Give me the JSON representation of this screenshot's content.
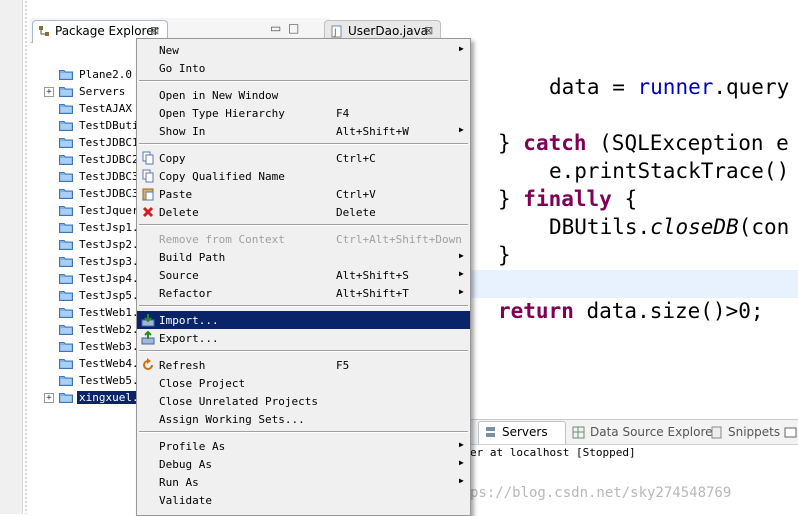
{
  "package_explorer": {
    "tab_label": "Package Explorer",
    "minimize_glyph": "▭",
    "maximize_glyph": "□",
    "close_glyph": "⊠",
    "tree": [
      {
        "label": "Plane2.0",
        "expandable": false
      },
      {
        "label": "Servers",
        "expandable": true
      },
      {
        "label": "TestAJAX",
        "expandable": false
      },
      {
        "label": "TestDButi",
        "expandable": false
      },
      {
        "label": "TestJDBC1",
        "expandable": false
      },
      {
        "label": "TestJDBC2",
        "expandable": false
      },
      {
        "label": "TestJDBC3",
        "expandable": false
      },
      {
        "label": "TestJDBC3",
        "expandable": false
      },
      {
        "label": "TestJquer",
        "expandable": false
      },
      {
        "label": "TestJsp1.",
        "expandable": false
      },
      {
        "label": "TestJsp2.",
        "expandable": false
      },
      {
        "label": "TestJsp3.",
        "expandable": false
      },
      {
        "label": "TestJsp4.",
        "expandable": false
      },
      {
        "label": "TestJsp5.",
        "expandable": false
      },
      {
        "label": "TestWeb1.",
        "expandable": false
      },
      {
        "label": "TestWeb2.",
        "expandable": false
      },
      {
        "label": "TestWeb3.",
        "expandable": false
      },
      {
        "label": "TestWeb4.",
        "expandable": false
      },
      {
        "label": "TestWeb5.",
        "expandable": false
      },
      {
        "label": "xingxuel.",
        "expandable": true,
        "selected": true
      }
    ]
  },
  "editor": {
    "tab_label": "UserDao.java",
    "code": {
      "l1_a": "data = ",
      "l1_b": "runner",
      "l1_c": ".query",
      "l2_a": "} ",
      "l2_kw": "catch",
      "l2_b": " (SQLException e",
      "l3": "e.printStackTrace()",
      "l4_a": "} ",
      "l4_kw": "finally",
      "l4_b": " {",
      "l5_a": "DBUtils.",
      "l5_it": "closeDB",
      "l5_b": "(con",
      "l6": "}",
      "l7_kw": "return",
      "l7_b": " data.size()>0;"
    }
  },
  "bottom_panel": {
    "tabs": [
      {
        "label": "Servers",
        "active": true
      },
      {
        "label": "Data Source Explorer",
        "active": false
      },
      {
        "label": "Snippets",
        "active": false
      }
    ],
    "server_text": "er at localhost  [Stopped]",
    "watermark": "ps://blog.csdn.net/sky274548769"
  },
  "context_menu": {
    "groups": [
      [
        {
          "label": "New",
          "shortcut": "",
          "submenu": true,
          "icon": ""
        },
        {
          "label": "Go Into",
          "shortcut": "",
          "submenu": false,
          "icon": ""
        }
      ],
      [
        {
          "label": "Open in New Window",
          "shortcut": "",
          "submenu": false,
          "icon": ""
        },
        {
          "label": "Open Type Hierarchy",
          "shortcut": "F4",
          "submenu": false,
          "icon": ""
        },
        {
          "label": "Show In",
          "shortcut": "Alt+Shift+W",
          "submenu": true,
          "icon": ""
        }
      ],
      [
        {
          "label": "Copy",
          "shortcut": "Ctrl+C",
          "submenu": false,
          "icon": "copy-icon"
        },
        {
          "label": "Copy Qualified Name",
          "shortcut": "",
          "submenu": false,
          "icon": "copy-icon"
        },
        {
          "label": "Paste",
          "shortcut": "Ctrl+V",
          "submenu": false,
          "icon": "paste-icon"
        },
        {
          "label": "Delete",
          "shortcut": "Delete",
          "submenu": false,
          "icon": "delete-icon"
        }
      ],
      [
        {
          "label": "Remove from Context",
          "shortcut": "Ctrl+Alt+Shift+Down",
          "submenu": false,
          "icon": "",
          "disabled": true
        },
        {
          "label": "Build Path",
          "shortcut": "",
          "submenu": true,
          "icon": ""
        },
        {
          "label": "Source",
          "shortcut": "Alt+Shift+S",
          "submenu": true,
          "icon": ""
        },
        {
          "label": "Refactor",
          "shortcut": "Alt+Shift+T",
          "submenu": true,
          "icon": ""
        }
      ],
      [
        {
          "label": "Import...",
          "shortcut": "",
          "submenu": false,
          "icon": "import-icon",
          "selected": true
        },
        {
          "label": "Export...",
          "shortcut": "",
          "submenu": false,
          "icon": "export-icon"
        }
      ],
      [
        {
          "label": "Refresh",
          "shortcut": "F5",
          "submenu": false,
          "icon": "refresh-icon"
        },
        {
          "label": "Close Project",
          "shortcut": "",
          "submenu": false,
          "icon": ""
        },
        {
          "label": "Close Unrelated Projects",
          "shortcut": "",
          "submenu": false,
          "icon": ""
        },
        {
          "label": "Assign Working Sets...",
          "shortcut": "",
          "submenu": false,
          "icon": ""
        }
      ],
      [
        {
          "label": "Profile As",
          "shortcut": "",
          "submenu": true,
          "icon": ""
        },
        {
          "label": "Debug As",
          "shortcut": "",
          "submenu": true,
          "icon": ""
        },
        {
          "label": "Run As",
          "shortcut": "",
          "submenu": true,
          "icon": ""
        },
        {
          "label": "Validate",
          "shortcut": "",
          "submenu": false,
          "icon": ""
        }
      ]
    ]
  },
  "colors": {
    "selection": "#0a246a",
    "keyword": "#7f0055",
    "field": "#0000c0",
    "menu_bg": "#f0f0f0"
  }
}
